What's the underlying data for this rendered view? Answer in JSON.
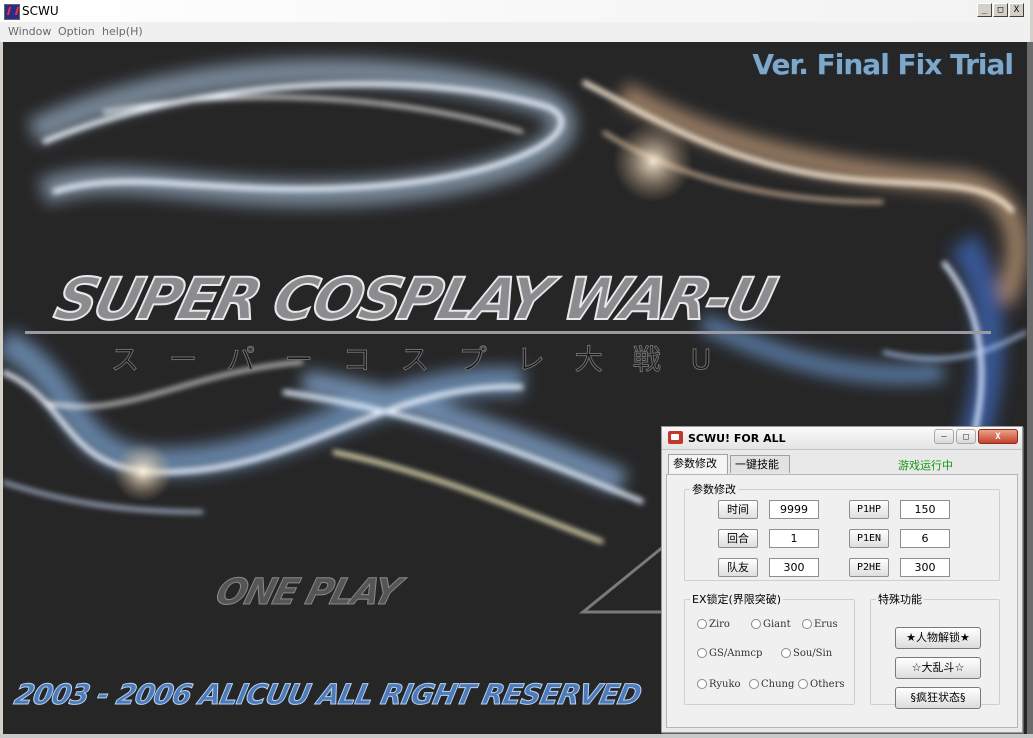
{
  "window": {
    "title": "SCWU"
  },
  "window_buttons": [
    "_",
    "□",
    "X"
  ],
  "menu": [
    "Window",
    "Option",
    "help(H)"
  ],
  "game": {
    "version": "Ver. Final Fix Trial",
    "logo": "SUPER COSPLAY WAR-U",
    "subtitle_jp": "スーパーコスプレ大戦U",
    "menu_option": "ONE PLAY",
    "copyright": "2003 - 2006  ALICUU ALL RIGHT RESERVED"
  },
  "trainer": {
    "title": "SCWU! FOR ALL",
    "title_buttons": [
      "—",
      "□",
      "X"
    ],
    "tabs": [
      "参数修改",
      "一键技能"
    ],
    "status": "游戏运行中",
    "params_group": "参数修改",
    "params": [
      {
        "label": "时间",
        "value": "9999"
      },
      {
        "label": "回合",
        "value": "1"
      },
      {
        "label": "队友",
        "value": "300"
      }
    ],
    "players": [
      {
        "label": "P1HP",
        "value": "150"
      },
      {
        "label": "P1EN",
        "value": "6"
      },
      {
        "label": "P2HE",
        "value": "300"
      }
    ],
    "ex_group": "EX锁定(界限突破)",
    "ex_options": [
      "Ziro",
      "Giant",
      "Erus",
      "GS/Anmcp",
      "Sou/Sin",
      "Ryuko",
      "Chung",
      "Others"
    ],
    "special_group": "特殊功能",
    "special": [
      "★人物解锁★",
      "☆大乱斗☆",
      "§疯狂状态§"
    ]
  }
}
